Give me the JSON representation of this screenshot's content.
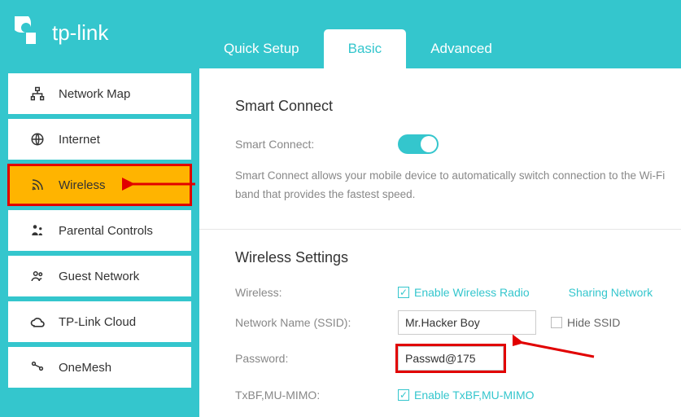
{
  "brand": "tp-link",
  "tabs": {
    "quick": "Quick Setup",
    "basic": "Basic",
    "advanced": "Advanced"
  },
  "sidebar": {
    "items": [
      {
        "label": "Network Map"
      },
      {
        "label": "Internet"
      },
      {
        "label": "Wireless"
      },
      {
        "label": "Parental Controls"
      },
      {
        "label": "Guest Network"
      },
      {
        "label": "TP-Link Cloud"
      },
      {
        "label": "OneMesh"
      }
    ]
  },
  "smart": {
    "title": "Smart Connect",
    "label": "Smart Connect:",
    "desc": "Smart Connect allows your mobile device to automatically switch connection to the Wi-Fi band that provides the fastest speed."
  },
  "wireless": {
    "title": "Wireless Settings",
    "wireless_label": "Wireless:",
    "enable_radio": "Enable Wireless Radio",
    "sharing": "Sharing Network",
    "ssid_label": "Network Name (SSID):",
    "ssid_value": "Mr.Hacker Boy",
    "hide_ssid": "Hide SSID",
    "pwd_label": "Password:",
    "pwd_value": "Passwd@175",
    "txbf_label": "TxBF,MU-MIMO:",
    "txbf_enable": "Enable TxBF,MU-MIMO"
  }
}
